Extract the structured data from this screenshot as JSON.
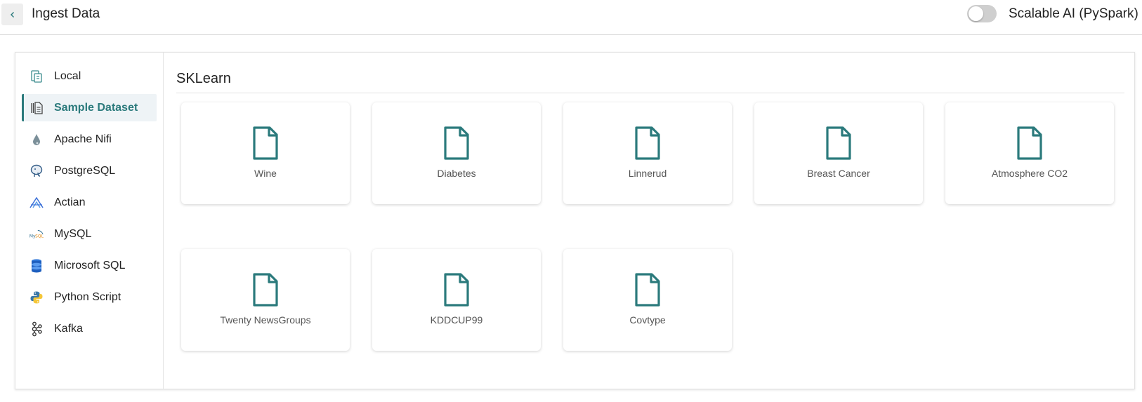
{
  "header": {
    "title": "Ingest Data",
    "toggle_label": "Scalable AI (PySpark)",
    "toggle_on": false
  },
  "sidebar": {
    "items": [
      {
        "label": "Local",
        "icon": "local-file-icon",
        "active": false
      },
      {
        "label": "Sample Dataset",
        "icon": "sample-dataset-icon",
        "active": true
      },
      {
        "label": "Apache Nifi",
        "icon": "apache-nifi-icon",
        "active": false
      },
      {
        "label": "PostgreSQL",
        "icon": "postgresql-icon",
        "active": false
      },
      {
        "label": "Actian",
        "icon": "actian-icon",
        "active": false
      },
      {
        "label": "MySQL",
        "icon": "mysql-icon",
        "active": false
      },
      {
        "label": "Microsoft SQL",
        "icon": "microsoft-sql-icon",
        "active": false
      },
      {
        "label": "Python Script",
        "icon": "python-icon",
        "active": false
      },
      {
        "label": "Kafka",
        "icon": "kafka-icon",
        "active": false
      }
    ]
  },
  "main": {
    "section_title": "SKLearn",
    "datasets": [
      {
        "label": "Wine"
      },
      {
        "label": "Diabetes"
      },
      {
        "label": "Linnerud"
      },
      {
        "label": "Breast Cancer"
      },
      {
        "label": "Atmosphere CO2"
      },
      {
        "label": "Twenty NewsGroups"
      },
      {
        "label": "KDDCUP99"
      },
      {
        "label": "Covtype"
      }
    ]
  },
  "colors": {
    "accent": "#2b7a7c",
    "active_bg": "#eef3f6",
    "toggle_off": "#cfcfcf"
  }
}
